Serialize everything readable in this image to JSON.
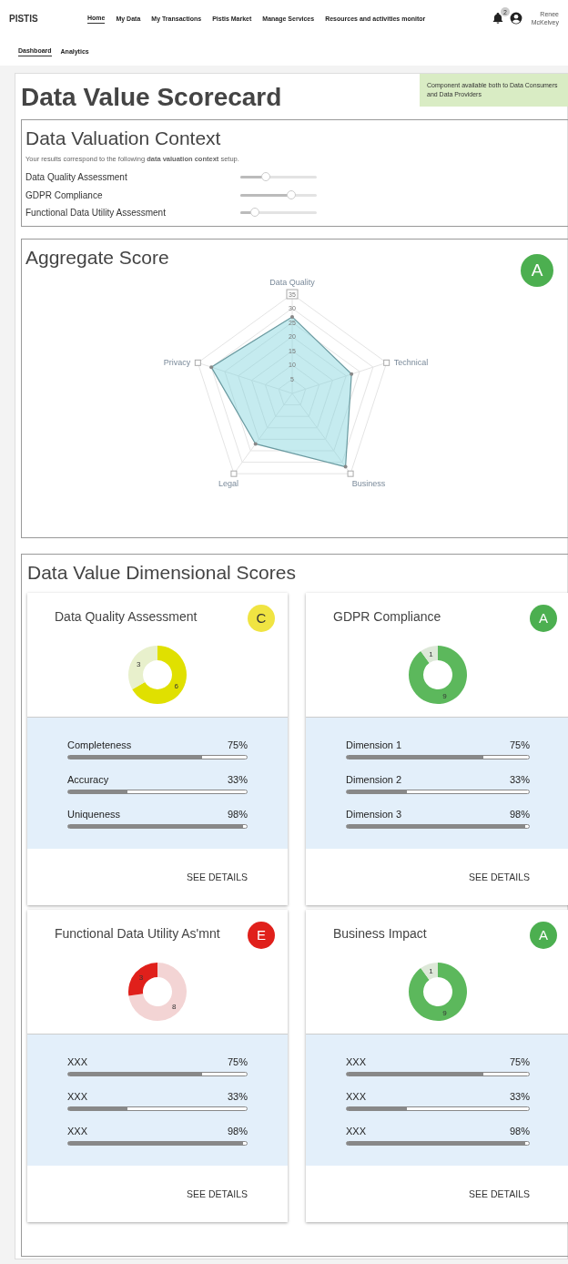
{
  "header": {
    "logo": "PISTIS",
    "nav": [
      {
        "label": "Home",
        "selected": true
      },
      {
        "label": "My Data",
        "selected": false
      },
      {
        "label": "My Transactions",
        "selected": false
      },
      {
        "label": "Pistis Market",
        "selected": false
      },
      {
        "label": "Manage Services",
        "selected": false
      },
      {
        "label": "Resources and activities monitor",
        "selected": false
      }
    ],
    "notifications": "2",
    "user": "Renee McKelvey"
  },
  "subnav": [
    {
      "label": "Dashboard",
      "selected": true
    },
    {
      "label": "Analytics",
      "selected": false
    }
  ],
  "page": {
    "title": "Data Value Scorecard",
    "note": "Component available both to Data Consumers and Data Providers"
  },
  "context": {
    "title": "Data Valuation Context",
    "intro": "Your results correspond to the following **data valuation context** setup.",
    "sliders": [
      {
        "label": "Data Quality Assessment",
        "level": 0.35
      },
      {
        "label": "GDPR Compliance",
        "level": 0.68
      },
      {
        "label": "Functional Data Utility Assessment",
        "level": 0.2
      }
    ]
  },
  "aggregate": {
    "title": "Aggregate Score",
    "grade": "A",
    "color": "#4caf50",
    "chart_data": {
      "type": "radar",
      "categories": [
        "Data Quality",
        "Technical",
        "Business",
        "Legal",
        "Privacy"
      ],
      "color": "#7fd3dc",
      "values": [
        27,
        22,
        32,
        22,
        30
      ],
      "ylim": [
        0,
        35
      ],
      "yticks": [
        5,
        10,
        15,
        20,
        25,
        30,
        35
      ]
    }
  },
  "dimensional": {
    "title": "Data Value Dimensional Scores",
    "cards": [
      {
        "title": "Data Quality Assessment",
        "grade": "C",
        "color": "#f0e442",
        "chart_data": {
          "type": "donut",
          "values": [
            6,
            3
          ],
          "colors": [
            "#e0e000",
            "#e8f0cc"
          ],
          "data_labels": true
        },
        "metrics": [
          {
            "label": "Completeness",
            "value": "75%",
            "level": 0.75
          },
          {
            "label": "Accuracy",
            "value": "33%",
            "level": 0.33
          },
          {
            "label": "Uniqueness",
            "value": "98%",
            "level": 0.98
          }
        ],
        "action": "SEE DETAILS"
      },
      {
        "title": "GDPR Compliance",
        "grade": "A",
        "color": "#4caf50",
        "chart_data": {
          "type": "donut",
          "values": [
            9,
            1
          ],
          "colors": [
            "#5cb85c",
            "#dde8d8"
          ],
          "data_labels": true
        },
        "metrics": [
          {
            "label": "Dimension 1",
            "value": "75%",
            "level": 0.75
          },
          {
            "label": "Dimension 2",
            "value": "33%",
            "level": 0.33
          },
          {
            "label": "Dimension 3",
            "value": "98%",
            "level": 0.98
          }
        ],
        "action": "SEE DETAILS"
      },
      {
        "title": "Functional Data Utility As'mnt",
        "grade": "E",
        "color": "#e0201b",
        "chart_data": {
          "type": "donut",
          "values": [
            8,
            3
          ],
          "colors": [
            "#f3d4d4",
            "#e0201b"
          ],
          "data_labels": true
        },
        "metrics": [
          {
            "label": "XXX",
            "value": "75%",
            "level": 0.75
          },
          {
            "label": "XXX",
            "value": "33%",
            "level": 0.33
          },
          {
            "label": "XXX",
            "value": "98%",
            "level": 0.98
          }
        ],
        "action": "SEE DETAILS"
      },
      {
        "title": "Business Impact",
        "grade": "A",
        "color": "#4caf50",
        "chart_data": {
          "type": "donut",
          "values": [
            9,
            1
          ],
          "colors": [
            "#5cb85c",
            "#dde8d8"
          ],
          "data_labels": true
        },
        "metrics": [
          {
            "label": "XXX",
            "value": "75%",
            "level": 0.75
          },
          {
            "label": "XXX",
            "value": "33%",
            "level": 0.33
          },
          {
            "label": "XXX",
            "value": "98%",
            "level": 0.98
          }
        ],
        "action": "SEE DETAILS"
      }
    ]
  }
}
